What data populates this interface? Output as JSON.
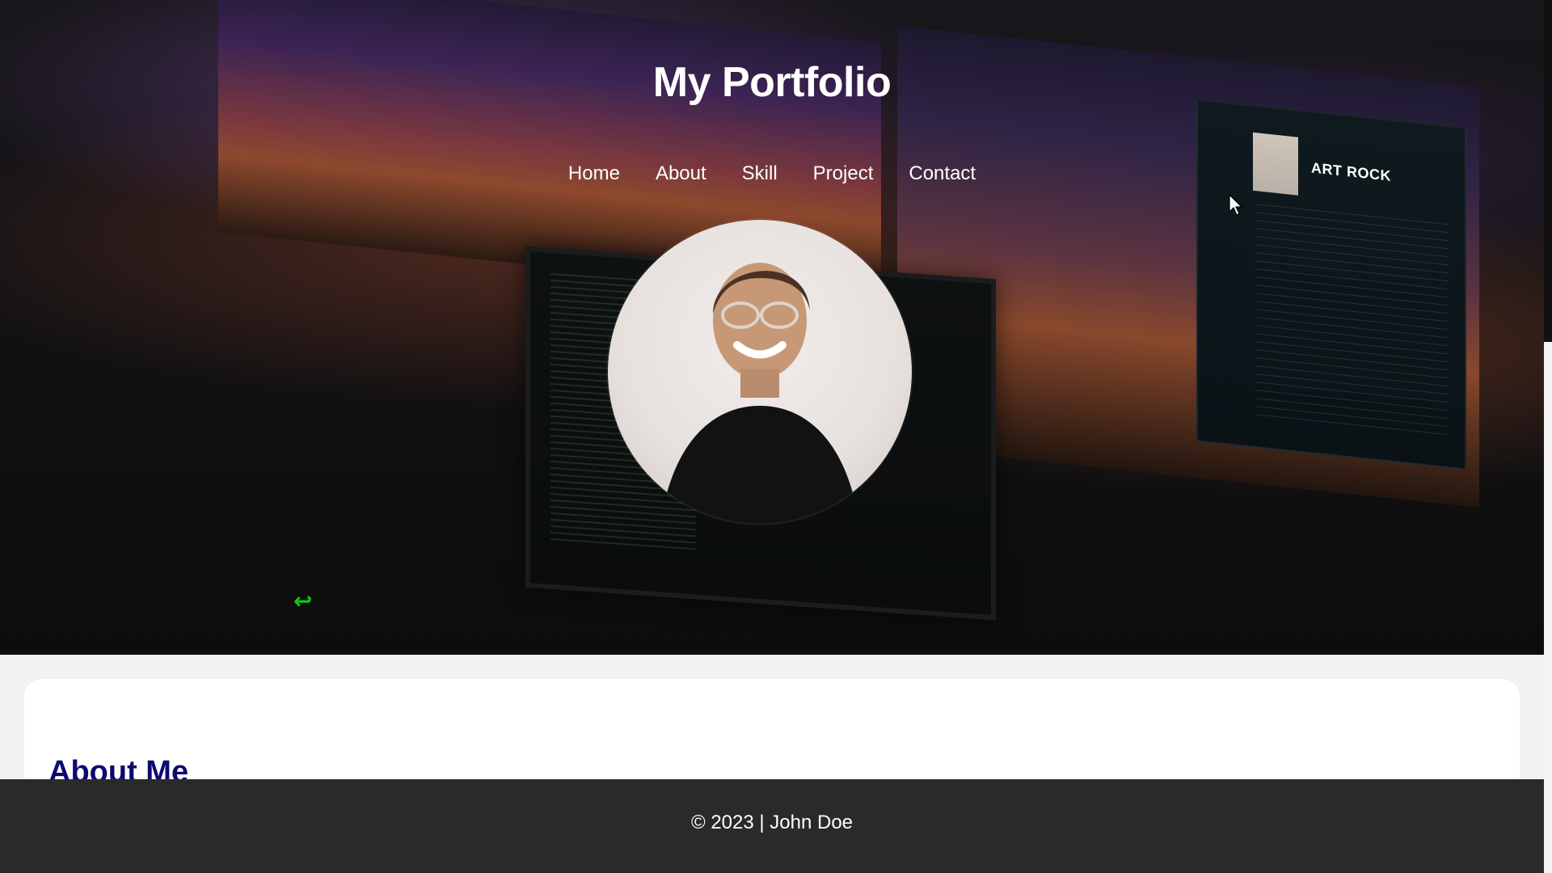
{
  "header": {
    "title": "My Portfolio",
    "nav_items": [
      "Home",
      "About",
      "Skill",
      "Project",
      "Contact"
    ]
  },
  "hero": {
    "playlist_title": "ART ROCK",
    "icons": {
      "back": "back-arrow-icon",
      "cursor": "mouse-cursor-icon"
    }
  },
  "about": {
    "title": "About Me"
  },
  "footer": {
    "text": "© 2023 | John Doe"
  },
  "colors": {
    "hero_background": "#0f0f10",
    "accent_green": "#16c21b",
    "about_title": "#0a0a6e",
    "footer_background": "#2a2a2b"
  }
}
